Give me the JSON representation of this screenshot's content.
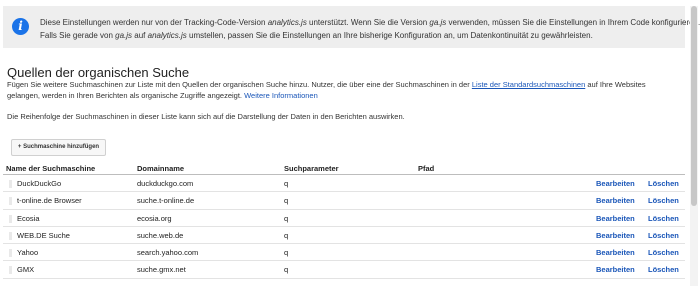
{
  "info": {
    "icon": "info-icon",
    "line1_a": "Diese Einstellungen werden nur von der Tracking-Code-Version ",
    "line1_b": "analytics.js",
    "line1_c": " unterstützt. Wenn Sie die Version ",
    "line1_d": "ga.js",
    "line1_e": " verwenden, müssen Sie die Einstellungen in Ihrem Code konfigurieren.",
    "line2_a": "Falls Sie gerade von ",
    "line2_b": "ga.js",
    "line2_c": " auf ",
    "line2_d": "analytics.js",
    "line2_e": " umstellen, passen Sie die Einstellungen an Ihre bisherige Konfiguration an, um Datenkontinuität zu gewährleisten."
  },
  "section": {
    "title": "Quellen der organischen Suche",
    "desc1_a": "Fügen Sie weitere Suchmaschinen zur Liste mit den Quellen der organischen Suche hinzu. Nutzer, die über eine der Suchmaschinen in der ",
    "desc1_link": "Liste der Standardsuchmaschinen",
    "desc1_b": " auf Ihre Websites",
    "desc2_a": "gelangen, werden in Ihren Berichten als organische Zugriffe angezeigt. ",
    "desc2_link": "Weitere Informationen",
    "desc3": "Die Reihenfolge der Suchmaschinen in dieser Liste kann sich auf die Darstellung der Daten in den Berichten auswirken.",
    "add_button": "+ Suchmaschine hinzufügen"
  },
  "table": {
    "headers": {
      "name": "Name der Suchmaschine",
      "domain": "Domainname",
      "param": "Suchparameter",
      "path": "Pfad"
    },
    "rows": [
      {
        "name": "DuckDuckGo",
        "domain": "duckduckgo.com",
        "param": "q",
        "path": "",
        "edit": "Bearbeiten",
        "delete": "Löschen"
      },
      {
        "name": "t-online.de Browser",
        "domain": "suche.t-online.de",
        "param": "q",
        "path": "",
        "edit": "Bearbeiten",
        "delete": "Löschen"
      },
      {
        "name": "Ecosia",
        "domain": "ecosia.org",
        "param": "q",
        "path": "",
        "edit": "Bearbeiten",
        "delete": "Löschen"
      },
      {
        "name": "WEB.DE Suche",
        "domain": "suche.web.de",
        "param": "q",
        "path": "",
        "edit": "Bearbeiten",
        "delete": "Löschen"
      },
      {
        "name": "Yahoo",
        "domain": "search.yahoo.com",
        "param": "q",
        "path": "",
        "edit": "Bearbeiten",
        "delete": "Löschen"
      },
      {
        "name": "GMX",
        "domain": "suche.gmx.net",
        "param": "q",
        "path": "",
        "edit": "Bearbeiten",
        "delete": "Löschen"
      }
    ]
  },
  "colors": {
    "link": "#1a56b8",
    "info_icon": "#1a73e8",
    "info_bg": "#eeeeee"
  }
}
